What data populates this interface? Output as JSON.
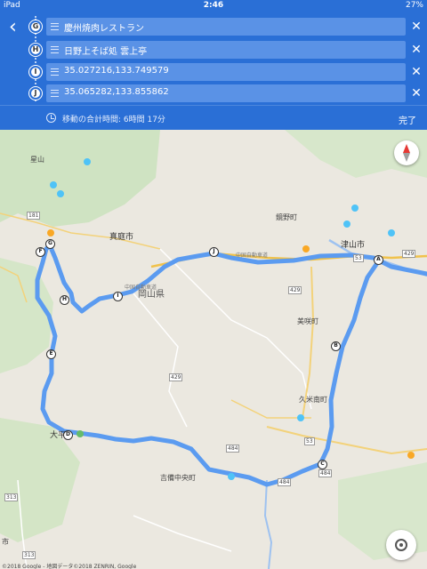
{
  "status_bar": {
    "device": "iPad",
    "time": "2:46",
    "battery": "27%"
  },
  "header": {
    "stops": [
      {
        "letter": "G",
        "label": "慶州焼肉レストラン"
      },
      {
        "letter": "H",
        "label": "日野上そば処 雲上亭"
      },
      {
        "letter": "I",
        "label": "35.027216,133.749579"
      },
      {
        "letter": "J",
        "label": "35.065282,133.855862"
      }
    ],
    "total_time": "移動の合計時間: 6時間 17分",
    "done_label": "完了"
  },
  "map": {
    "labels": {
      "hoshiyama": "星山",
      "maniwa": "真庭市",
      "okayama_pref": "岡山県",
      "kagamino": "鏡野町",
      "tsuyama": "津山市",
      "misaki": "美咲町",
      "kumenan": "久米南町",
      "ohira": "大平",
      "kibichuo": "吉備中央町",
      "city_bottom_left": "市",
      "expressway_w": "中国自動車道",
      "expressway_e": "中国自動車道"
    },
    "route_numbers": [
      "181",
      "313",
      "429",
      "429",
      "429",
      "53",
      "53",
      "484",
      "484",
      "484",
      "313"
    ],
    "waypoints": [
      "A",
      "B",
      "C",
      "D",
      "E",
      "F",
      "G",
      "H",
      "I",
      "J"
    ],
    "route_color": "#5b9bf0",
    "copyright": "©2018 Google - 地図データ©2018 ZENRIN, Google"
  }
}
